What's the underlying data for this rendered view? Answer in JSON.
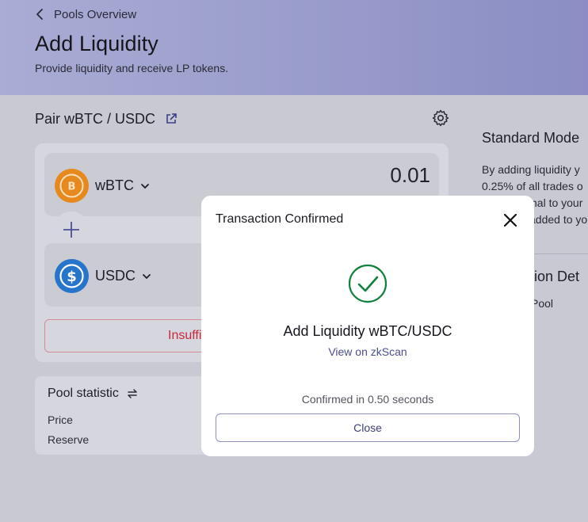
{
  "header": {
    "back_label": "Pools Overview",
    "title": "Add Liquidity",
    "subtitle": "Provide liquidity and receive LP tokens."
  },
  "pair": {
    "label": "Pair wBTC / USDC"
  },
  "inputs": {
    "token_a": {
      "symbol": "wBTC",
      "amount": "0.01",
      "color": "#f7931a"
    },
    "token_b": {
      "symbol": "USDC",
      "amount": "",
      "color": "#2775ca"
    }
  },
  "action_button": {
    "label": "Insuffi"
  },
  "pool_statistic": {
    "title": "Pool statistic",
    "rows": [
      {
        "label": "Price"
      },
      {
        "label": "Reserve"
      }
    ]
  },
  "side_panel": {
    "title": "Standard Mode",
    "lines": [
      "By adding liquidity y",
      "0.25% of all trades o",
      "nal to your",
      "added to yo"
    ],
    "section_title": "ction Det",
    "section_text": "Pool"
  },
  "modal": {
    "title": "Transaction Confirmed",
    "heading": "Add Liquidity wBTC/USDC",
    "link_label": "View on zkScan",
    "meta": "Confirmed in 0.50 seconds",
    "close_label": "Close",
    "success_color": "#12813e"
  }
}
